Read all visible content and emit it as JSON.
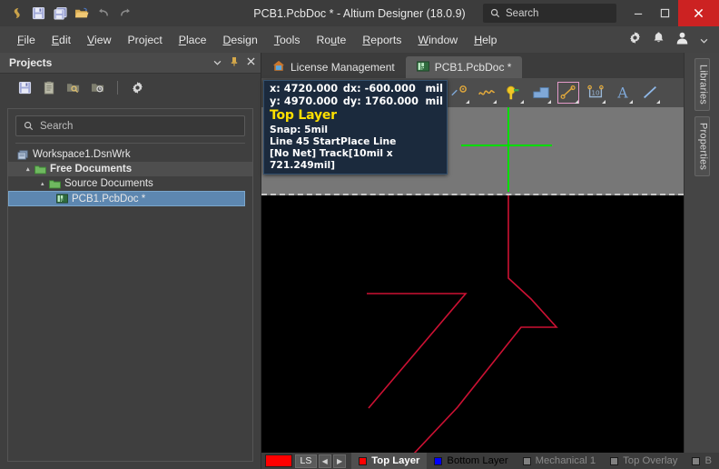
{
  "titlebar": {
    "title": "PCB1.PcbDoc * - Altium Designer (18.0.9)",
    "icons": [
      "altium-logo",
      "save",
      "save-all",
      "open",
      "undo",
      "redo"
    ],
    "search_placeholder": "Search",
    "minimize": "—",
    "maximize": "❐",
    "close": "✕"
  },
  "menubar": {
    "items": [
      {
        "label": "File",
        "accel": "F"
      },
      {
        "label": "Edit",
        "accel": "E"
      },
      {
        "label": "View",
        "accel": "V"
      },
      {
        "label": "Project",
        "accel": "j"
      },
      {
        "label": "Place",
        "accel": "P"
      },
      {
        "label": "Design",
        "accel": "D"
      },
      {
        "label": "Tools",
        "accel": "T"
      },
      {
        "label": "Route",
        "accel": "u"
      },
      {
        "label": "Reports",
        "accel": "R"
      },
      {
        "label": "Window",
        "accel": "W"
      },
      {
        "label": "Help",
        "accel": "H"
      }
    ],
    "right_icons": [
      "gear-icon",
      "bell-icon",
      "user-icon",
      "chevron-down-icon"
    ]
  },
  "projects": {
    "title": "Projects",
    "header_buttons": [
      "chevron-down-icon",
      "pin-icon",
      "close-icon"
    ],
    "toolbar_icons": [
      "save-icon",
      "clipboard-icon",
      "folder-search-icon",
      "folder-history-icon",
      "gear-icon"
    ],
    "search_placeholder": "Search",
    "tree": [
      {
        "label": "Workspace1.DsnWrk",
        "level": 0,
        "icon": "workspace-icon",
        "expander": "",
        "selected": false,
        "highlight": false
      },
      {
        "label": "Free Documents",
        "level": 1,
        "icon": "folder-icon",
        "expander": "▴",
        "selected": false,
        "highlight": true
      },
      {
        "label": "Source Documents",
        "level": 2,
        "icon": "folder-icon",
        "expander": "▴",
        "selected": false,
        "highlight": false
      },
      {
        "label": "PCB1.PcbDoc *",
        "level": 3,
        "icon": "pcb-icon",
        "expander": "",
        "selected": true,
        "highlight": false
      }
    ]
  },
  "tabs": [
    {
      "label": "License Management",
      "icon": "home-icon",
      "active": false
    },
    {
      "label": "PCB1.PcbDoc *",
      "icon": "pcb-icon",
      "active": true
    }
  ],
  "pcb_toolbar": {
    "tools": [
      {
        "name": "place-pad-icon",
        "boxed": false
      },
      {
        "name": "place-polygon-icon",
        "boxed": false
      },
      {
        "name": "place-via-icon",
        "boxed": false
      },
      {
        "name": "place-fill-icon",
        "boxed": false
      },
      {
        "name": "place-line-icon",
        "boxed": true
      },
      {
        "name": "place-dimension-icon",
        "boxed": false
      },
      {
        "name": "place-string-icon",
        "boxed": false
      },
      {
        "name": "place-track-icon",
        "boxed": false
      }
    ]
  },
  "tooltip": {
    "x_key": "x:",
    "x_value": "4720.000",
    "dx_key": "dx:",
    "dx_value": "-600.000",
    "dx_unit": "mil",
    "y_key": "y:",
    "y_value": "4970.000",
    "dy_key": "dy:",
    "dy_value": "1760.000",
    "dy_unit": "mil",
    "layer": "Top Layer",
    "snap": "Snap: 5mil",
    "line": "Line 45 StartPlace Line",
    "track": "[No Net] Track[10mil x 721.249mil]"
  },
  "right_panels": [
    {
      "label": "Libraries"
    },
    {
      "label": "Properties"
    }
  ],
  "layerbar": {
    "current_color": "#ff0000",
    "ls_button": "LS",
    "prev_arrow": "◀",
    "next_arrow": "▶",
    "layers": [
      {
        "label": "Top Layer",
        "color": "#ff0000",
        "active": true
      },
      {
        "label": "Bottom Layer",
        "color": "#0000ff",
        "active": false
      },
      {
        "label": "Mechanical 1",
        "color": "#808080",
        "active": false
      },
      {
        "label": "Top Overlay",
        "color": "#808080",
        "active": false
      },
      {
        "label": "B",
        "color": "#808080",
        "active": false
      }
    ]
  },
  "canvas": {
    "cursor_color": "#00dd00",
    "trace_color": "#cc1133",
    "board_color": "#777777",
    "background": "#000000"
  }
}
